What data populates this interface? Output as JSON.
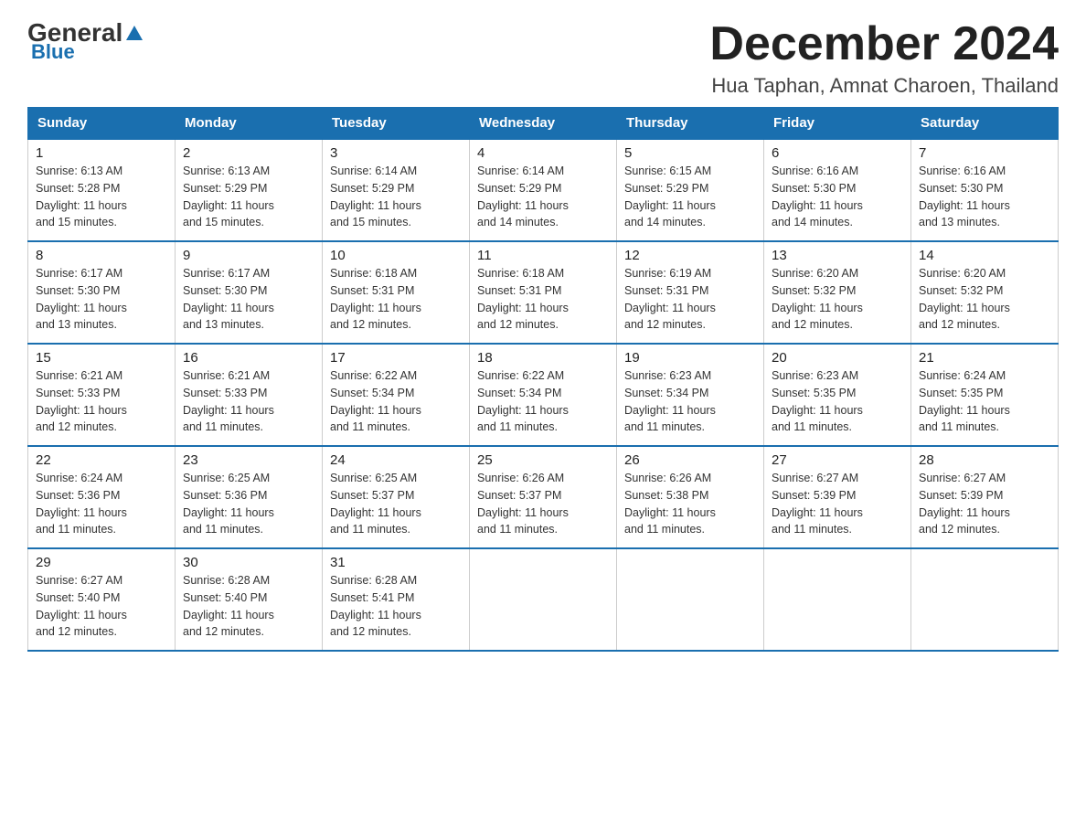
{
  "logo": {
    "general": "General",
    "blue": "Blue"
  },
  "header": {
    "month_title": "December 2024",
    "location": "Hua Taphan, Amnat Charoen, Thailand"
  },
  "days_of_week": [
    "Sunday",
    "Monday",
    "Tuesday",
    "Wednesday",
    "Thursday",
    "Friday",
    "Saturday"
  ],
  "weeks": [
    [
      {
        "day": "1",
        "sunrise": "6:13 AM",
        "sunset": "5:28 PM",
        "daylight": "11 hours and 15 minutes."
      },
      {
        "day": "2",
        "sunrise": "6:13 AM",
        "sunset": "5:29 PM",
        "daylight": "11 hours and 15 minutes."
      },
      {
        "day": "3",
        "sunrise": "6:14 AM",
        "sunset": "5:29 PM",
        "daylight": "11 hours and 15 minutes."
      },
      {
        "day": "4",
        "sunrise": "6:14 AM",
        "sunset": "5:29 PM",
        "daylight": "11 hours and 14 minutes."
      },
      {
        "day": "5",
        "sunrise": "6:15 AM",
        "sunset": "5:29 PM",
        "daylight": "11 hours and 14 minutes."
      },
      {
        "day": "6",
        "sunrise": "6:16 AM",
        "sunset": "5:30 PM",
        "daylight": "11 hours and 14 minutes."
      },
      {
        "day": "7",
        "sunrise": "6:16 AM",
        "sunset": "5:30 PM",
        "daylight": "11 hours and 13 minutes."
      }
    ],
    [
      {
        "day": "8",
        "sunrise": "6:17 AM",
        "sunset": "5:30 PM",
        "daylight": "11 hours and 13 minutes."
      },
      {
        "day": "9",
        "sunrise": "6:17 AM",
        "sunset": "5:30 PM",
        "daylight": "11 hours and 13 minutes."
      },
      {
        "day": "10",
        "sunrise": "6:18 AM",
        "sunset": "5:31 PM",
        "daylight": "11 hours and 12 minutes."
      },
      {
        "day": "11",
        "sunrise": "6:18 AM",
        "sunset": "5:31 PM",
        "daylight": "11 hours and 12 minutes."
      },
      {
        "day": "12",
        "sunrise": "6:19 AM",
        "sunset": "5:31 PM",
        "daylight": "11 hours and 12 minutes."
      },
      {
        "day": "13",
        "sunrise": "6:20 AM",
        "sunset": "5:32 PM",
        "daylight": "11 hours and 12 minutes."
      },
      {
        "day": "14",
        "sunrise": "6:20 AM",
        "sunset": "5:32 PM",
        "daylight": "11 hours and 12 minutes."
      }
    ],
    [
      {
        "day": "15",
        "sunrise": "6:21 AM",
        "sunset": "5:33 PM",
        "daylight": "11 hours and 12 minutes."
      },
      {
        "day": "16",
        "sunrise": "6:21 AM",
        "sunset": "5:33 PM",
        "daylight": "11 hours and 11 minutes."
      },
      {
        "day": "17",
        "sunrise": "6:22 AM",
        "sunset": "5:34 PM",
        "daylight": "11 hours and 11 minutes."
      },
      {
        "day": "18",
        "sunrise": "6:22 AM",
        "sunset": "5:34 PM",
        "daylight": "11 hours and 11 minutes."
      },
      {
        "day": "19",
        "sunrise": "6:23 AM",
        "sunset": "5:34 PM",
        "daylight": "11 hours and 11 minutes."
      },
      {
        "day": "20",
        "sunrise": "6:23 AM",
        "sunset": "5:35 PM",
        "daylight": "11 hours and 11 minutes."
      },
      {
        "day": "21",
        "sunrise": "6:24 AM",
        "sunset": "5:35 PM",
        "daylight": "11 hours and 11 minutes."
      }
    ],
    [
      {
        "day": "22",
        "sunrise": "6:24 AM",
        "sunset": "5:36 PM",
        "daylight": "11 hours and 11 minutes."
      },
      {
        "day": "23",
        "sunrise": "6:25 AM",
        "sunset": "5:36 PM",
        "daylight": "11 hours and 11 minutes."
      },
      {
        "day": "24",
        "sunrise": "6:25 AM",
        "sunset": "5:37 PM",
        "daylight": "11 hours and 11 minutes."
      },
      {
        "day": "25",
        "sunrise": "6:26 AM",
        "sunset": "5:37 PM",
        "daylight": "11 hours and 11 minutes."
      },
      {
        "day": "26",
        "sunrise": "6:26 AM",
        "sunset": "5:38 PM",
        "daylight": "11 hours and 11 minutes."
      },
      {
        "day": "27",
        "sunrise": "6:27 AM",
        "sunset": "5:39 PM",
        "daylight": "11 hours and 11 minutes."
      },
      {
        "day": "28",
        "sunrise": "6:27 AM",
        "sunset": "5:39 PM",
        "daylight": "11 hours and 12 minutes."
      }
    ],
    [
      {
        "day": "29",
        "sunrise": "6:27 AM",
        "sunset": "5:40 PM",
        "daylight": "11 hours and 12 minutes."
      },
      {
        "day": "30",
        "sunrise": "6:28 AM",
        "sunset": "5:40 PM",
        "daylight": "11 hours and 12 minutes."
      },
      {
        "day": "31",
        "sunrise": "6:28 AM",
        "sunset": "5:41 PM",
        "daylight": "11 hours and 12 minutes."
      },
      null,
      null,
      null,
      null
    ]
  ],
  "labels": {
    "sunrise": "Sunrise:",
    "sunset": "Sunset:",
    "daylight": "Daylight:"
  }
}
